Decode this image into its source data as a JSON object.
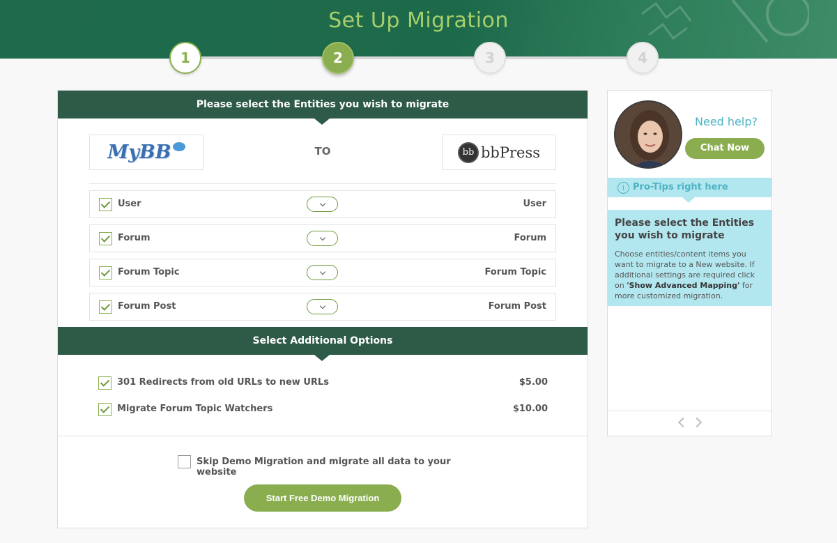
{
  "header": {
    "title": "Set Up Migration"
  },
  "steps": [
    "1",
    "2",
    "3",
    "4"
  ],
  "entities_section": {
    "title": "Please select the Entities you wish to migrate",
    "source_logo": "MyBB",
    "target_logo": "bbPress",
    "target_logo_mark": "bb",
    "to_label": "TO",
    "rows": [
      {
        "source": "User",
        "target": "User",
        "checked": true
      },
      {
        "source": "Forum",
        "target": "Forum",
        "checked": true
      },
      {
        "source": "Forum Topic",
        "target": "Forum Topic",
        "checked": true
      },
      {
        "source": "Forum Post",
        "target": "Forum Post",
        "checked": true
      }
    ]
  },
  "options_section": {
    "title": "Select Additional Options",
    "options": [
      {
        "label": "301 Redirects from old URLs to new URLs",
        "price": "$5.00",
        "checked": true
      },
      {
        "label": "Migrate Forum Topic Watchers",
        "price": "$10.00",
        "checked": true
      }
    ]
  },
  "skip_demo": {
    "label": "Skip Demo Migration and migrate all data to your website",
    "checked": false
  },
  "start_button": "Start Free Demo Migration",
  "help": {
    "need_help": "Need help?",
    "chat_button": "Chat Now",
    "tips_label": "Pro-Tips right here",
    "tip_title": "Please select the Entities you wish to migrate",
    "tip_text_1": "Choose entities/content items you want to migrate to a New website. If additional settings are required click on ",
    "tip_text_bold": "'Show Advanced Mapping'",
    "tip_text_2": " for more customized migration."
  },
  "colors": {
    "accent_green": "#8aae4f",
    "header_green": "#1f6a4c",
    "section_dark": "#2e5a48",
    "tips_blue": "#b3e7ef",
    "link_teal": "#4db3c4"
  }
}
